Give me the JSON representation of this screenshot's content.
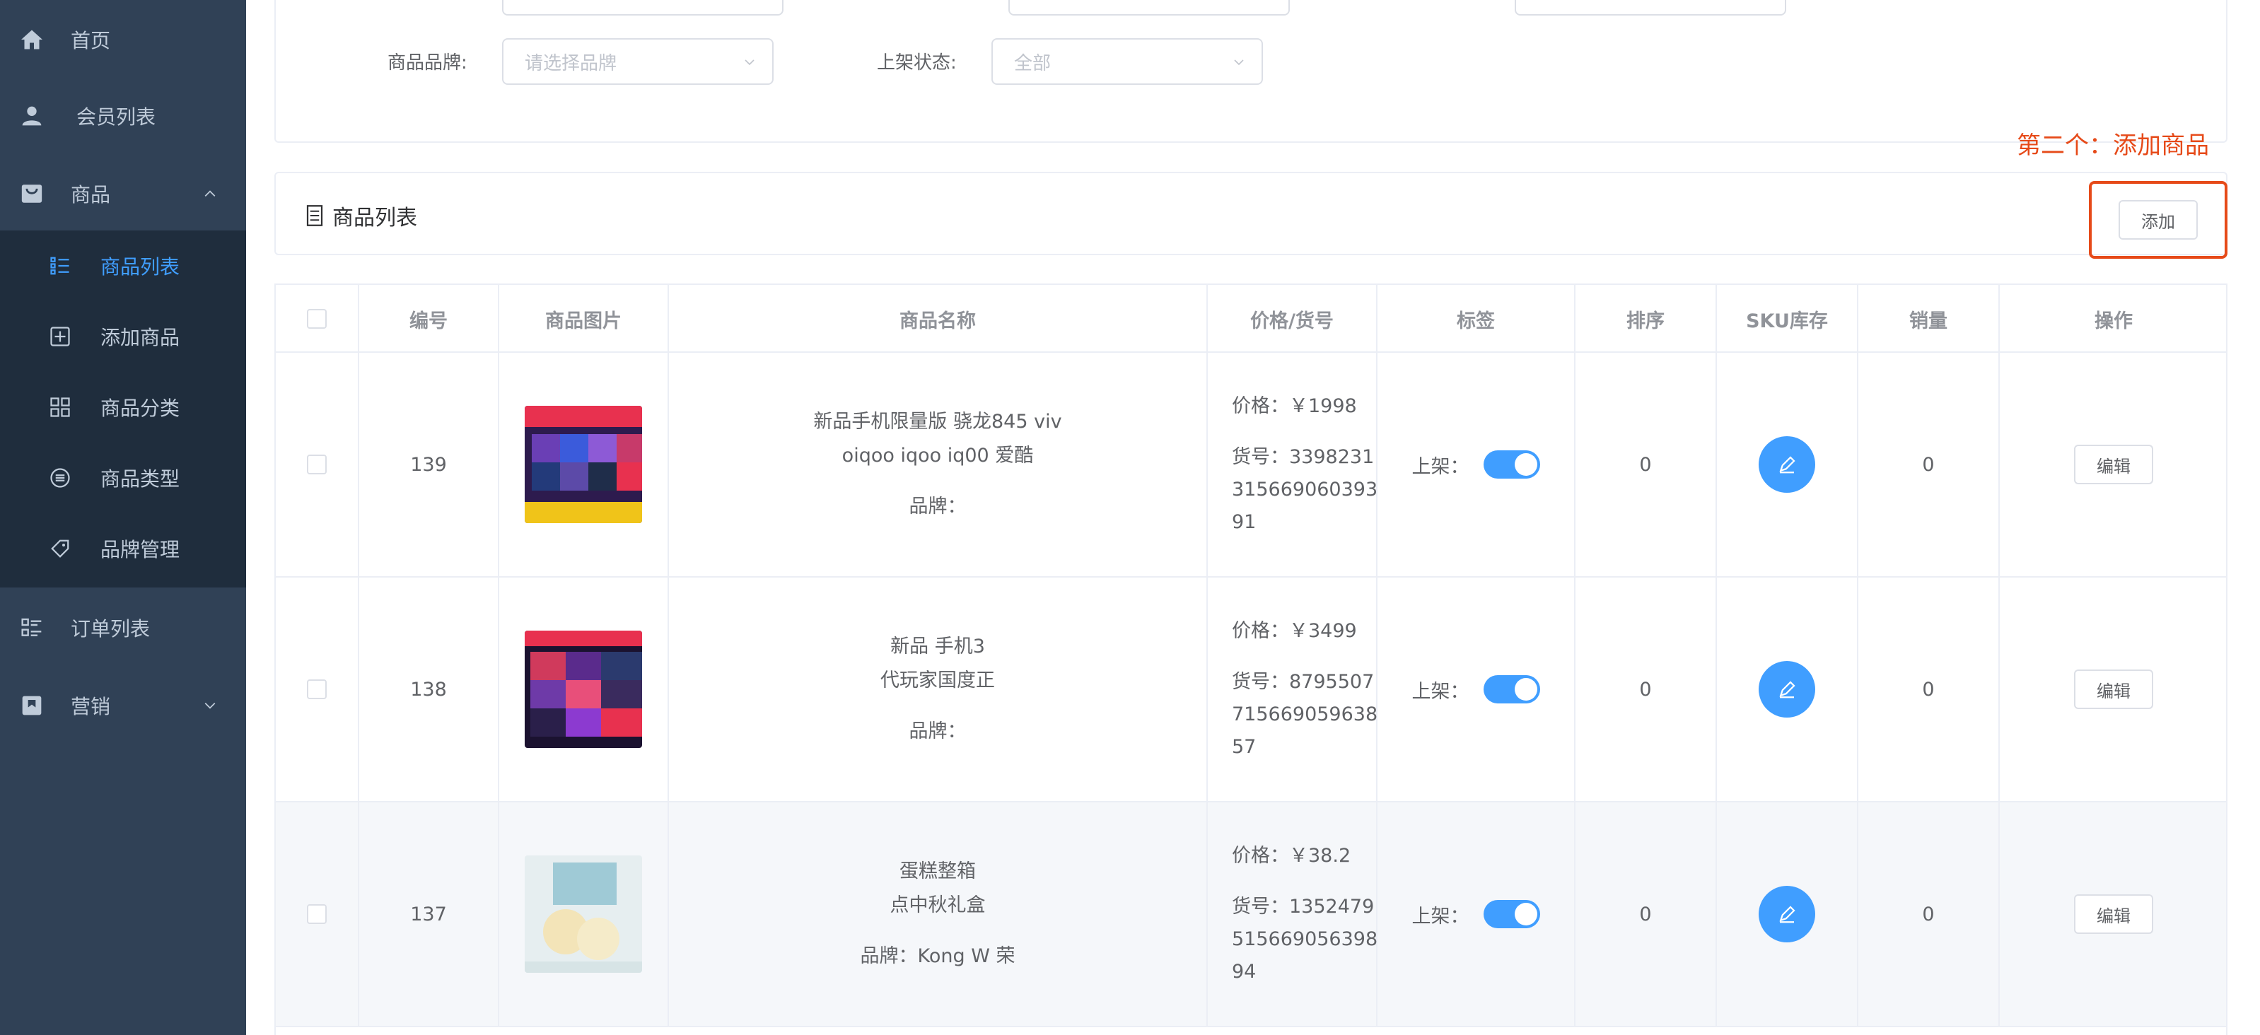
{
  "sidebar": {
    "items": [
      {
        "label": "首页",
        "icon": "home-icon"
      },
      {
        "label": "会员列表",
        "icon": "user-icon"
      },
      {
        "label": "商品",
        "icon": "shopping-bag-icon",
        "expanded": true
      },
      {
        "label": "订单列表",
        "icon": "order-list-icon"
      },
      {
        "label": "营销",
        "icon": "marketing-icon"
      }
    ],
    "sub_items": [
      {
        "label": "商品列表",
        "icon": "list-icon",
        "active": true
      },
      {
        "label": "添加商品",
        "icon": "add-square-icon"
      },
      {
        "label": "商品分类",
        "icon": "grid-icon"
      },
      {
        "label": "商品类型",
        "icon": "circle-list-icon"
      },
      {
        "label": "品牌管理",
        "icon": "tag-icon"
      }
    ]
  },
  "filters": {
    "brand_label": "商品品牌:",
    "brand_placeholder": "请选择品牌",
    "status_label": "上架状态:",
    "status_value": "全部"
  },
  "list_header": {
    "title": "商品列表",
    "add_button": "添加"
  },
  "annotation": "第二个：添加商品",
  "table": {
    "columns": [
      "编号",
      "商品图片",
      "商品名称",
      "价格/货号",
      "标签",
      "排序",
      "SKU库存",
      "销量",
      "操作"
    ],
    "rows": [
      {
        "id": "139",
        "name_line1": "新品手机限量版 骁龙845 viv",
        "name_line2": "oiqoo iqoo iq00 爱酷",
        "brand": "品牌：",
        "price": "价格：￥1998",
        "sku_no": "货号：339823131566906039391",
        "sku_line1": "货号：3398231",
        "sku_line2": "315669060393",
        "sku_line3": "91",
        "tag_label": "上架：",
        "on_shelf": true,
        "sort": "0",
        "sales": "0",
        "edit": "编辑"
      },
      {
        "id": "138",
        "name_line1": "新品 手机3",
        "name_line2": "代玩家国度正",
        "brand": "品牌：",
        "price": "价格：￥3499",
        "sku_line1": "货号：8795507",
        "sku_line2": "715669059638",
        "sku_line3": "57",
        "tag_label": "上架：",
        "on_shelf": true,
        "sort": "0",
        "sales": "0",
        "edit": "编辑"
      },
      {
        "id": "137",
        "name_line1": "蛋糕整箱",
        "name_line2": "点中秋礼盒",
        "brand": "品牌：Kong W 荣",
        "price": "价格：￥38.2",
        "sku_line1": "货号：1352479",
        "sku_line2": "515669056398",
        "sku_line3": "94",
        "tag_label": "上架：",
        "on_shelf": true,
        "sort": "0",
        "sales": "0",
        "edit": "编辑"
      }
    ]
  },
  "colors": {
    "sidebar_bg": "#304156",
    "submenu_bg": "#1f2d3d",
    "accent": "#409eff",
    "annotation_red": "#e64a19"
  }
}
